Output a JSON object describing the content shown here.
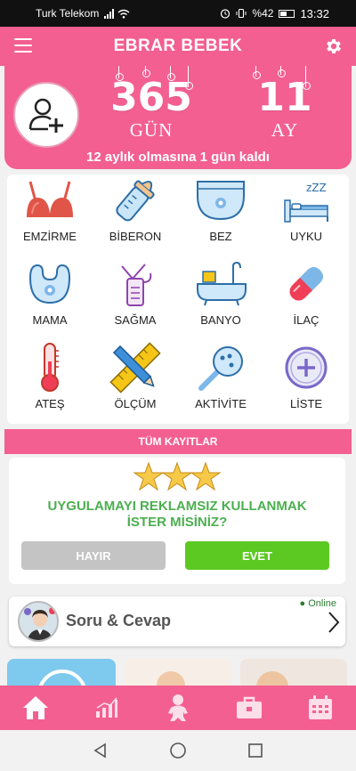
{
  "status_bar": {
    "carrier": "Turk Telekom",
    "battery": "%42",
    "time": "13:32"
  },
  "header": {
    "title": "EBRAR BEBEK"
  },
  "hero": {
    "days_value": "365",
    "days_label": "GÜN",
    "months_value": "11",
    "months_label": "AY",
    "remaining_text": "12 aylık olmasına 1 gün kaldı"
  },
  "activities": [
    {
      "label": "EMZİRME",
      "icon": "bra-icon"
    },
    {
      "label": "BİBERON",
      "icon": "baby-bottle-icon"
    },
    {
      "label": "BEZ",
      "icon": "diaper-icon"
    },
    {
      "label": "UYKU",
      "icon": "sleep-bed-icon"
    },
    {
      "label": "MAMA",
      "icon": "bib-icon"
    },
    {
      "label": "SAĞMA",
      "icon": "breast-pump-icon"
    },
    {
      "label": "BANYO",
      "icon": "bathtub-icon"
    },
    {
      "label": "İLAÇ",
      "icon": "pill-icon"
    },
    {
      "label": "ATEŞ",
      "icon": "thermometer-icon"
    },
    {
      "label": "ÖLÇÜM",
      "icon": "ruler-pencil-icon"
    },
    {
      "label": "AKTİVİTE",
      "icon": "rattle-icon"
    },
    {
      "label": "LİSTE",
      "icon": "add-circle-icon"
    }
  ],
  "all_records_label": "TÜM KAYITLAR",
  "promo": {
    "question": "UYGULAMAYI REKLAMSIZ KULLANMAK İSTER MİSİNİZ?",
    "no_label": "HAYIR",
    "yes_label": "EVET"
  },
  "qa": {
    "label": "Soru & Cevap",
    "status": "Online"
  },
  "bottom_nav": [
    "home-icon",
    "chart-icon",
    "baby-icon",
    "toolbox-icon",
    "calendar-icon"
  ],
  "colors": {
    "brand_pink": "#f35f91",
    "promo_green": "#4caf50",
    "yes_green": "#5cc922",
    "no_gray": "#c4c4c4"
  }
}
